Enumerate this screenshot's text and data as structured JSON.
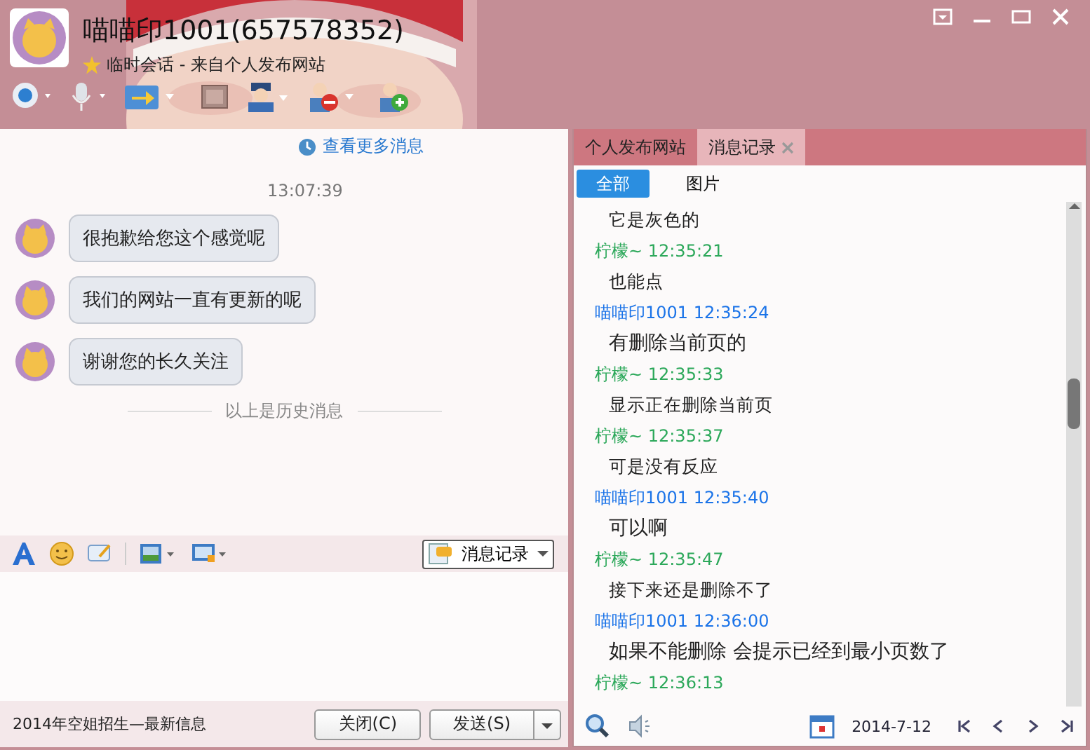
{
  "header": {
    "name": "喵喵印1001(657578352)",
    "subtitle": "临时会话 - 来自个人发布网站"
  },
  "chat": {
    "more_link": "查看更多消息",
    "time": "13:07:39",
    "messages": [
      "很抱歉给您这个感觉呢",
      "我们的网站一直有更新的呢",
      "谢谢您的长久关注"
    ],
    "history_divider": "以上是历史消息"
  },
  "input_toolbar": {
    "history_button": "消息记录"
  },
  "footer": {
    "ad_text": "2014年空姐招生—最新信息",
    "close_button": "关闭(C)",
    "send_button": "发送(S)"
  },
  "side_tabs": [
    {
      "label": "个人发布网站",
      "selected": false,
      "closable": false
    },
    {
      "label": "消息记录",
      "selected": true,
      "closable": true
    }
  ],
  "filter_tabs": [
    {
      "label": "全部",
      "selected": true
    },
    {
      "label": "图片",
      "selected": false
    }
  ],
  "history": [
    {
      "kind": "message",
      "text": "它是灰色的"
    },
    {
      "kind": "sender",
      "color": "#2ca85a",
      "text": "柠檬~ 12:35:21"
    },
    {
      "kind": "message",
      "text": "也能点"
    },
    {
      "kind": "sender",
      "color": "#1a73e8",
      "text": "喵喵印1001 12:35:24"
    },
    {
      "kind": "large_message",
      "text": "有删除当前页的"
    },
    {
      "kind": "sender",
      "color": "#2ca85a",
      "text": "柠檬~ 12:35:33"
    },
    {
      "kind": "message",
      "text": "显示正在删除当前页"
    },
    {
      "kind": "sender",
      "color": "#2ca85a",
      "text": "柠檬~ 12:35:37"
    },
    {
      "kind": "message",
      "text": "可是没有反应"
    },
    {
      "kind": "sender",
      "color": "#1a73e8",
      "text": "喵喵印1001 12:35:40"
    },
    {
      "kind": "large_message",
      "text": "可以啊"
    },
    {
      "kind": "sender",
      "color": "#2ca85a",
      "text": "柠檬~ 12:35:47"
    },
    {
      "kind": "message",
      "text": "接下来还是删除不了"
    },
    {
      "kind": "sender",
      "color": "#1a73e8",
      "text": "喵喵印1001 12:36:00"
    },
    {
      "kind": "large_message",
      "text": "如果不能删除 会提示已经到最小页数了"
    },
    {
      "kind": "sender",
      "color": "#2ca85a",
      "text": "柠檬~ 12:36:13"
    }
  ],
  "history_footer": {
    "date": "2014-7-12"
  }
}
